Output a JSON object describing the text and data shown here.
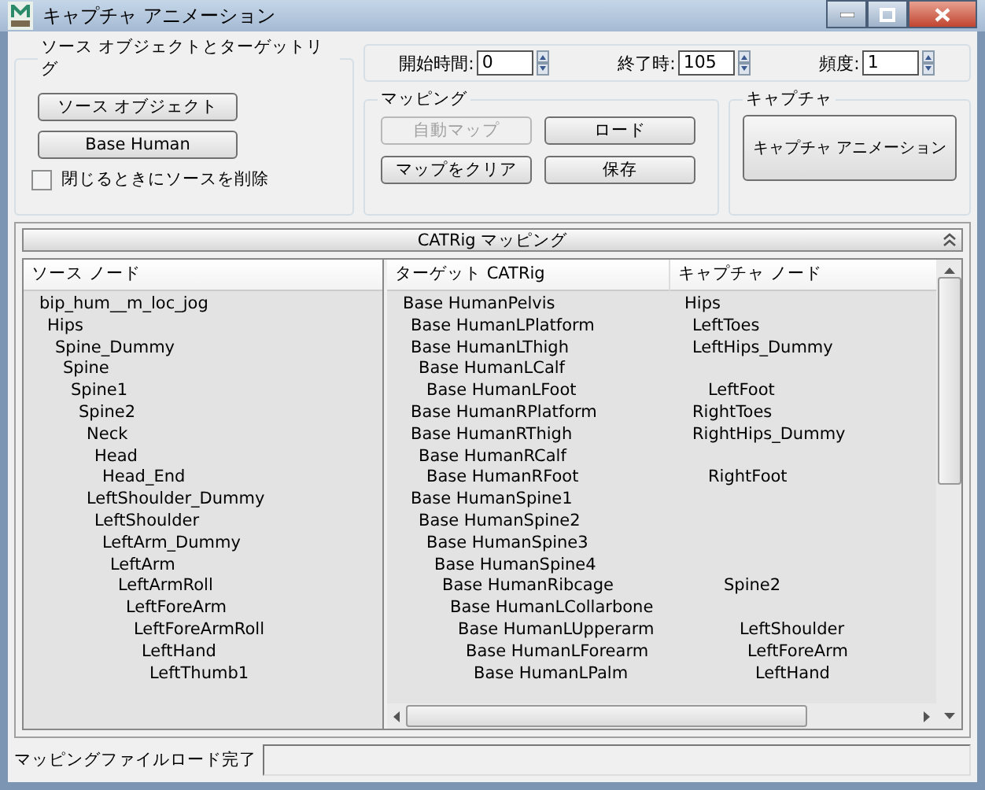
{
  "window": {
    "title": "キャプチャ アニメーション"
  },
  "source_group": {
    "title": "ソース オブジェクトとターゲットリグ",
    "source_button": "ソース オブジェクト",
    "target_button": "Base Human",
    "delete_on_close": {
      "label": "閉じるときにソースを削除",
      "checked": false
    }
  },
  "time": [
    {
      "label": "開始時間:",
      "value": "0"
    },
    {
      "label": "終了時:",
      "value": "105"
    },
    {
      "label": "頻度:",
      "value": "1"
    }
  ],
  "mapping_group": {
    "title": "マッピング",
    "buttons": [
      {
        "label": "自動マップ",
        "disabled": true
      },
      {
        "label": "ロード",
        "disabled": false
      },
      {
        "label": "マップをクリア",
        "disabled": false
      },
      {
        "label": "保存",
        "disabled": false
      }
    ]
  },
  "capture_group": {
    "title": "キャプチャ",
    "button": "キャプチャ アニメーション"
  },
  "rollout": {
    "title": "CATRig マッピング",
    "expanded": true
  },
  "source_nodes": {
    "header": "ソース ノード",
    "items": [
      {
        "label": "bip_hum__m_loc_jog",
        "children": [
          {
            "label": "Hips",
            "children": [
              {
                "label": "Spine_Dummy",
                "children": [
                  {
                    "label": "Spine",
                    "children": [
                      {
                        "label": "Spine1",
                        "children": [
                          {
                            "label": "Spine2",
                            "children": [
                              {
                                "label": "Neck",
                                "children": [
                                  {
                                    "label": "Head",
                                    "children": [
                                      {
                                        "label": "Head_End"
                                      }
                                    ]
                                  }
                                ]
                              },
                              {
                                "label": "LeftShoulder_Dummy",
                                "children": [
                                  {
                                    "label": "LeftShoulder",
                                    "children": [
                                      {
                                        "label": "LeftArm_Dummy",
                                        "children": [
                                          {
                                            "label": "LeftArm",
                                            "children": [
                                              {
                                                "label": "LeftArmRoll",
                                                "children": [
                                                  {
                                                    "label": "LeftForeArm",
                                                    "children": [
                                                      {
                                                        "label": "LeftForeArmRoll",
                                                        "children": [
                                                          {
                                                            "label": "LeftHand",
                                                            "children": [
                                                              {
                                                                "label": "LeftThumb1"
                                                              }
                                                            ]
                                                          }
                                                        ]
                                                      }
                                                    ]
                                                  }
                                                ]
                                              }
                                            ]
                                          }
                                        ]
                                      }
                                    ]
                                  }
                                ]
                              }
                            ]
                          }
                        ]
                      }
                    ]
                  }
                ]
              }
            ]
          }
        ]
      }
    ]
  },
  "target_table": {
    "columns": [
      "ターゲット CATRig",
      "キャプチャ ノード"
    ],
    "rows": [
      {
        "target": "Base HumanPelvis",
        "capture": "Hips",
        "children": [
          {
            "target": "Base HumanLPlatform",
            "capture": "LeftToes"
          },
          {
            "target": "Base HumanLThigh",
            "capture": "LeftHips_Dummy",
            "children": [
              {
                "target": "Base HumanLCalf",
                "children": [
                  {
                    "target": "Base HumanLFoot",
                    "capture": "LeftFoot"
                  }
                ]
              }
            ]
          },
          {
            "target": "Base HumanRPlatform",
            "capture": "RightToes"
          },
          {
            "target": "Base HumanRThigh",
            "capture": "RightHips_Dummy",
            "children": [
              {
                "target": "Base HumanRCalf",
                "children": [
                  {
                    "target": "Base HumanRFoot",
                    "capture": "RightFoot"
                  }
                ]
              }
            ]
          },
          {
            "target": "Base HumanSpine1",
            "children": [
              {
                "target": "Base HumanSpine2",
                "children": [
                  {
                    "target": "Base HumanSpine3",
                    "children": [
                      {
                        "target": "Base HumanSpine4",
                        "children": [
                          {
                            "target": "Base HumanRibcage",
                            "capture": "Spine2",
                            "children": [
                              {
                                "target": "Base HumanLCollarbone",
                                "children": [
                                  {
                                    "target": "Base HumanLUpperarm",
                                    "capture": "LeftShoulder",
                                    "children": [
                                      {
                                        "target": "Base HumanLForearm",
                                        "capture": "LeftForeArm",
                                        "children": [
                                          {
                                            "target": "Base HumanLPalm",
                                            "capture": "LeftHand"
                                          }
                                        ]
                                      }
                                    ]
                                  }
                                ]
                              }
                            ]
                          }
                        ]
                      }
                    ]
                  }
                ]
              }
            ]
          }
        ]
      }
    ]
  },
  "status_bar": {
    "message": "マッピングファイルロード完了"
  }
}
